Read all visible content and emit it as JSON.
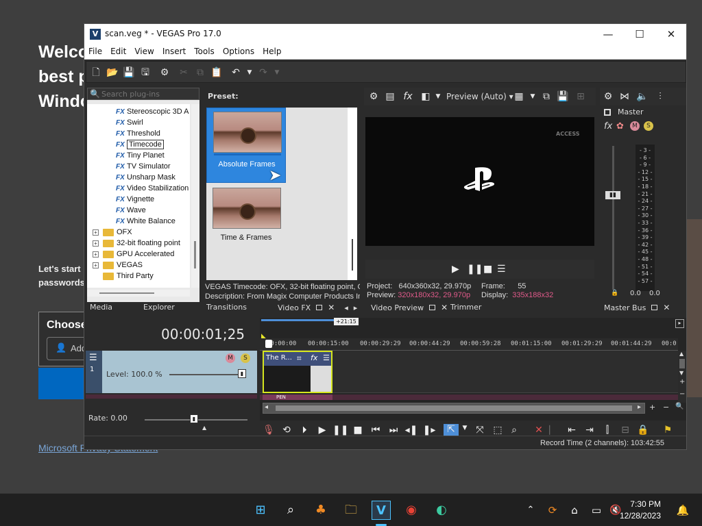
{
  "background_page": {
    "heading_line1": "Welco",
    "heading_line2": "best p",
    "heading_line3": "Windo",
    "lets_start": "Let's start",
    "passwords": "passwords",
    "choose_label": "Choose",
    "add_label": "Add",
    "privacy_link": "Microsoft Privacy Statement"
  },
  "window": {
    "title": "scan.veg * - VEGAS Pro 17.0",
    "app_icon_letter": "V"
  },
  "menu": [
    "File",
    "Edit",
    "View",
    "Insert",
    "Tools",
    "Options",
    "Help"
  ],
  "plugins": {
    "search_placeholder": "Search plug-ins",
    "fx_badge": "FX",
    "items": [
      {
        "label": "Stereoscopic 3D A"
      },
      {
        "label": "Swirl"
      },
      {
        "label": "Threshold"
      },
      {
        "label": "Timecode"
      },
      {
        "label": "Tiny Planet"
      },
      {
        "label": "TV Simulator"
      },
      {
        "label": "Unsharp Mask"
      },
      {
        "label": "Video Stabilization"
      },
      {
        "label": "Vignette"
      },
      {
        "label": "Wave"
      },
      {
        "label": "White Balance"
      }
    ],
    "folders": [
      {
        "label": "OFX"
      },
      {
        "label": "32-bit floating point"
      },
      {
        "label": "GPU Accelerated"
      },
      {
        "label": "VEGAS"
      },
      {
        "label": "Third Party"
      }
    ]
  },
  "preset": {
    "label": "Preset:",
    "tiles": [
      {
        "name": "Absolute Frames"
      },
      {
        "name": "Time & Frames"
      }
    ],
    "description_line1": "VEGAS Timecode: OFX, 32-bit floating point, GI",
    "description_line2": "Description: From Magix Computer Products In"
  },
  "tabs": {
    "media": "Media",
    "explorer": "Explorer",
    "transitions": "Transitions",
    "video_fx": "Video FX",
    "video_preview": "Video Preview",
    "trimmer": "Trimmer",
    "master_bus": "Master Bus"
  },
  "preview": {
    "mode": "Preview (Auto)",
    "watermark": "ACCESS",
    "project_label": "Project:",
    "project_value": "640x360x32, 29.970p",
    "preview_label": "Preview:",
    "preview_value": "320x180x32, 29.970p",
    "frame_label": "Frame:",
    "frame_value": "55",
    "display_label": "Display:",
    "display_value": "335x188x32"
  },
  "master": {
    "label": "Master",
    "meter_ticks": [
      "- 3 -",
      "- 6 -",
      "- 9 -",
      "- 12 -",
      "- 15 -",
      "- 18 -",
      "- 21 -",
      "- 24 -",
      "- 27 -",
      "- 30 -",
      "- 33 -",
      "- 36 -",
      "- 39 -",
      "- 42 -",
      "- 45 -",
      "- 48 -",
      "- 51 -",
      "- 54 -",
      "- 57 -"
    ],
    "left_value": "0.0",
    "right_value": "0.0"
  },
  "timeline": {
    "timecode": "00:00:01;25",
    "cursor_badge": "+21:15",
    "level_label": "Level: 100.0 %",
    "track_number": "1",
    "rate_label": "Rate: 0.00",
    "clip_title": "The R...",
    "ruler_labels": [
      "00:00:00",
      "00:00:15:00",
      "00:00:29:29",
      "00:00:44:29",
      "00:00:59:28",
      "00:01:15:00",
      "00:01:29:29",
      "00:01:44:29",
      "00:0"
    ],
    "track2_label": "PEN"
  },
  "status": {
    "record_time": "Record Time (2 channels): 103:42:55"
  },
  "taskbar": {
    "time": "7:30 PM",
    "date": "12/28/2023"
  },
  "colors": {
    "accent_blue": "#2e86de",
    "clip_border": "#d6e61e",
    "pink_value": "#e05a8a"
  }
}
